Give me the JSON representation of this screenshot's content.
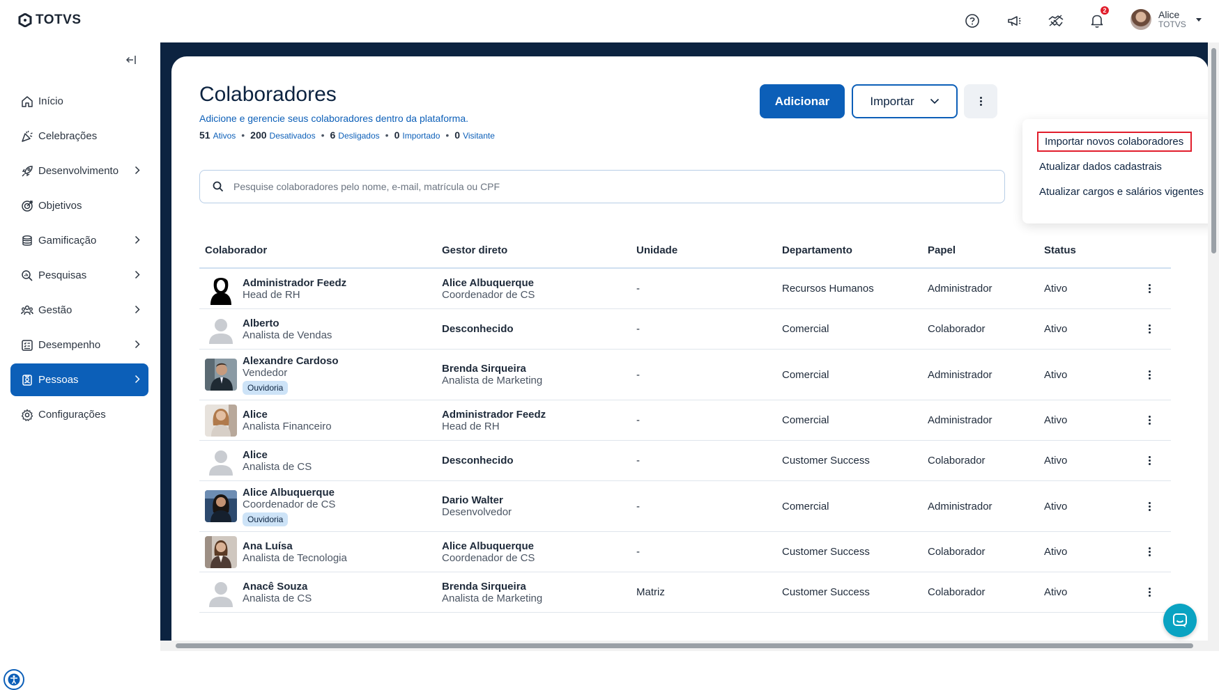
{
  "brand": {
    "name": "TOTVS"
  },
  "header": {
    "notifications_count": "2",
    "user": {
      "name": "Alice",
      "org": "TOTVS"
    }
  },
  "sidebar": {
    "items": [
      {
        "label": "Início",
        "icon": "home-icon",
        "has_children": false,
        "active": false
      },
      {
        "label": "Celebrações",
        "icon": "party-icon",
        "has_children": false,
        "active": false
      },
      {
        "label": "Desenvolvimento",
        "icon": "rocket-icon",
        "has_children": true,
        "active": false
      },
      {
        "label": "Objetivos",
        "icon": "target-icon",
        "has_children": false,
        "active": false
      },
      {
        "label": "Gamificação",
        "icon": "coins-icon",
        "has_children": true,
        "active": false
      },
      {
        "label": "Pesquisas",
        "icon": "search-chart-icon",
        "has_children": true,
        "active": false
      },
      {
        "label": "Gestão",
        "icon": "team-icon",
        "has_children": true,
        "active": false
      },
      {
        "label": "Desempenho",
        "icon": "checklist-icon",
        "has_children": true,
        "active": false
      },
      {
        "label": "Pessoas",
        "icon": "badge-icon",
        "has_children": true,
        "active": true
      },
      {
        "label": "Configurações",
        "icon": "gear-icon",
        "has_children": false,
        "active": false
      }
    ]
  },
  "page": {
    "title": "Colaboradores",
    "subtitle": "Adicione e gerencie seus colaboradores dentro da plataforma.",
    "stats": [
      {
        "value": "51",
        "label": "Ativos"
      },
      {
        "value": "200",
        "label": "Desativados"
      },
      {
        "value": "6",
        "label": "Desligados"
      },
      {
        "value": "0",
        "label": "Importado"
      },
      {
        "value": "0",
        "label": "Visitante"
      }
    ],
    "add_label": "Adicionar",
    "import_label": "Importar",
    "search_placeholder": "Pesquise colaboradores pelo nome, e-mail, matrícula ou CPF"
  },
  "import_menu": {
    "items": [
      "Importar novos colaboradores",
      "Atualizar dados cadastrais",
      "Atualizar cargos e salários vigentes"
    ],
    "highlighted_index": 0
  },
  "table": {
    "columns": [
      "Colaborador",
      "Gestor direto",
      "Unidade",
      "Departamento",
      "Papel",
      "Status"
    ],
    "rows": [
      {
        "name": "Administrador Feedz",
        "role": "Head de RH",
        "tag": "",
        "avatar": "silhouette",
        "manager_name": "Alice Albuquerque",
        "manager_role": "Coordenador de CS",
        "unit": "-",
        "dept": "Recursos Humanos",
        "papel": "Administrador",
        "status": "Ativo"
      },
      {
        "name": "Alberto",
        "role": "Analista de Vendas",
        "tag": "",
        "avatar": "placeholder",
        "manager_name": "Desconhecido",
        "manager_role": "",
        "unit": "-",
        "dept": "Comercial",
        "papel": "Colaborador",
        "status": "Ativo"
      },
      {
        "name": "Alexandre Cardoso",
        "role": "Vendedor",
        "tag": "Ouvidoria",
        "avatar": "photo-man",
        "manager_name": "Brenda Sirqueira",
        "manager_role": "Analista de Marketing",
        "unit": "-",
        "dept": "Comercial",
        "papel": "Administrador",
        "status": "Ativo"
      },
      {
        "name": "Alice",
        "role": "Analista Financeiro",
        "tag": "",
        "avatar": "photo-woman-light",
        "manager_name": "Administrador Feedz",
        "manager_role": "Head de RH",
        "unit": "-",
        "dept": "Comercial",
        "papel": "Administrador",
        "status": "Ativo"
      },
      {
        "name": "Alice",
        "role": "Analista de CS",
        "tag": "",
        "avatar": "placeholder",
        "manager_name": "Desconhecido",
        "manager_role": "",
        "unit": "-",
        "dept": "Customer Success",
        "papel": "Colaborador",
        "status": "Ativo"
      },
      {
        "name": "Alice Albuquerque",
        "role": "Coordenador de CS",
        "tag": "Ouvidoria",
        "avatar": "photo-woman-dark",
        "manager_name": "Dario Walter",
        "manager_role": "Desenvolvedor",
        "unit": "-",
        "dept": "Comercial",
        "papel": "Administrador",
        "status": "Ativo"
      },
      {
        "name": "Ana Luísa",
        "role": "Analista de Tecnologia",
        "tag": "",
        "avatar": "photo-woman-suit",
        "manager_name": "Alice Albuquerque",
        "manager_role": "Coordenador de CS",
        "unit": "-",
        "dept": "Customer Success",
        "papel": "Colaborador",
        "status": "Ativo"
      },
      {
        "name": "Anacê Souza",
        "role": "Analista de CS",
        "tag": "",
        "avatar": "placeholder",
        "manager_name": "Brenda Sirqueira",
        "manager_role": "Analista de Marketing",
        "unit": "Matriz",
        "dept": "Customer Success",
        "papel": "Colaborador",
        "status": "Ativo"
      }
    ]
  }
}
